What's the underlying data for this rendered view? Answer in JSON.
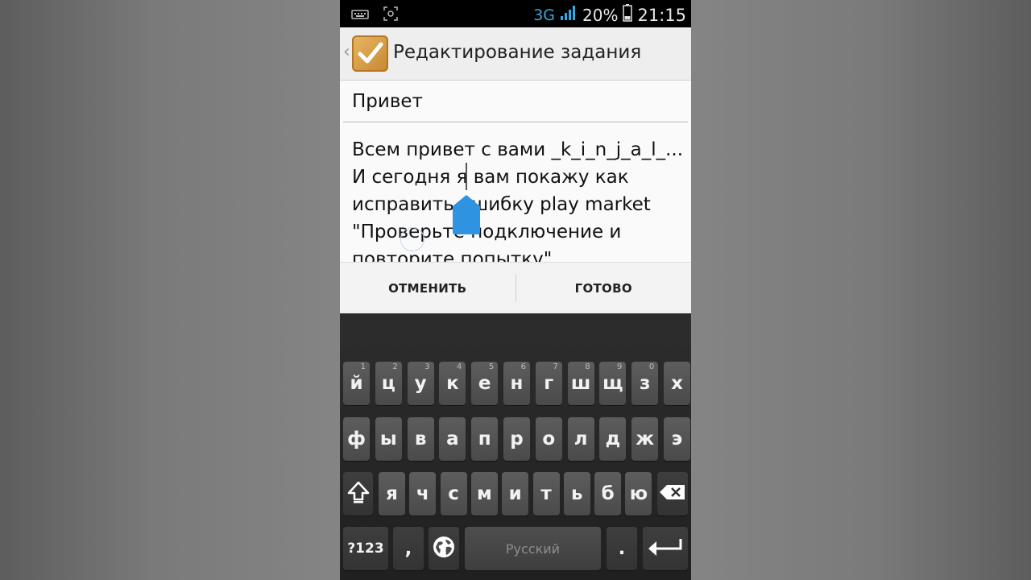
{
  "status_bar": {
    "network": "3G",
    "battery": "20%",
    "time": "21:15"
  },
  "action_bar": {
    "title": "Редактирование задания"
  },
  "task": {
    "title": "Привет",
    "body_lines": [
      "Всем привет с вами _k_i_n_j_a_l_...",
      "И сегодня я вам покажу как",
      "исправить ошибку play market",
      "\"Проверьте подключение и",
      "повторите попытку\""
    ]
  },
  "dialog": {
    "cancel": "ОТМЕНИТЬ",
    "done": "ГОТОВО"
  },
  "keyboard": {
    "row1": [
      {
        "k": "й",
        "h": "1"
      },
      {
        "k": "ц",
        "h": "2"
      },
      {
        "k": "у",
        "h": "3"
      },
      {
        "k": "к",
        "h": "4"
      },
      {
        "k": "е",
        "h": "5"
      },
      {
        "k": "н",
        "h": "6"
      },
      {
        "k": "г",
        "h": "7"
      },
      {
        "k": "ш",
        "h": "8"
      },
      {
        "k": "щ",
        "h": "9"
      },
      {
        "k": "з",
        "h": "0"
      },
      {
        "k": "х",
        "h": ""
      }
    ],
    "row2": [
      "ф",
      "ы",
      "в",
      "а",
      "п",
      "р",
      "о",
      "л",
      "д",
      "ж",
      "э"
    ],
    "row3": [
      "я",
      "ч",
      "с",
      "м",
      "и",
      "т",
      "ь",
      "б",
      "ю"
    ],
    "symbols_label": "?123",
    "comma_label": ",",
    "space_label": "Русский",
    "period_label": ".",
    "icons": {
      "shift": "shift-icon",
      "delete": "backspace-icon",
      "language": "globe-icon",
      "enter": "enter-icon"
    }
  }
}
